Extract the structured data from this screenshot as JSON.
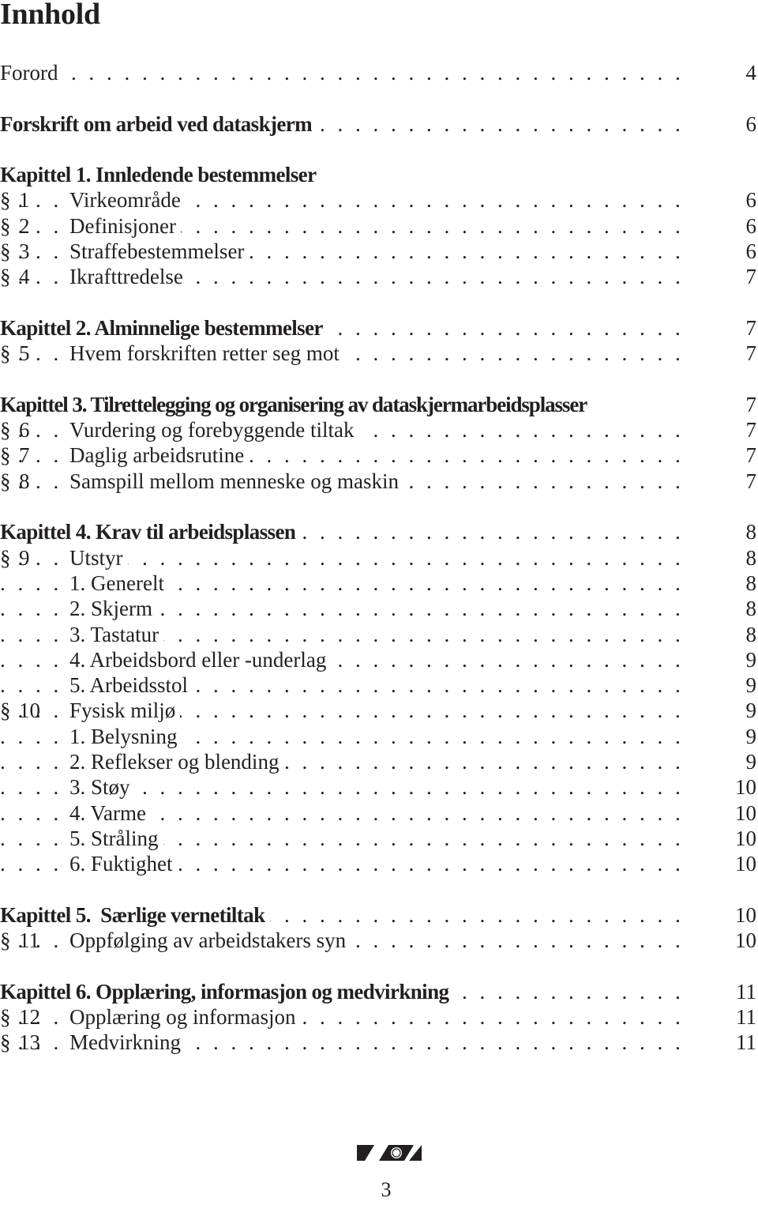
{
  "title": "Innhold",
  "leader_dots": ". . . . . . . . . . . . . . . . . . . . . . . . . . . . . . . . . . . . . . . . . . . . . . . . . . . . . . . . . . . . . . . . . . . .",
  "section_symbol": "§",
  "entries": [
    {
      "type": "plain",
      "label": "Forord",
      "page": "4"
    },
    {
      "type": "heading",
      "label": "Forskrift om arbeid ved dataskjerm",
      "page": "6"
    },
    {
      "type": "heading",
      "label": "Kapittel 1. Innledende bestemmelser",
      "page": ""
    },
    {
      "type": "section",
      "num": "1",
      "label": "Virkeområde",
      "page": "6"
    },
    {
      "type": "section",
      "num": "2",
      "label": "Definisjoner",
      "page": "6"
    },
    {
      "type": "section",
      "num": "3",
      "label": "Straffebestemmelser",
      "page": "6"
    },
    {
      "type": "section",
      "num": "4",
      "label": "Ikrafttredelse",
      "page": "7"
    },
    {
      "type": "heading",
      "label": "Kapittel 2. Alminnelige bestemmelser",
      "page": "7"
    },
    {
      "type": "section",
      "num": "5",
      "label": "Hvem forskriften retter seg mot",
      "page": "7"
    },
    {
      "type": "heading",
      "label": "Kapittel 3. Tilrettelegging og organisering av dataskjermarbeidsplasser",
      "page": "7"
    },
    {
      "type": "section",
      "num": "6",
      "label": "Vurdering og forebyggende tiltak",
      "page": "7"
    },
    {
      "type": "section",
      "num": "7",
      "label": "Daglig arbeidsrutine",
      "page": "7"
    },
    {
      "type": "section",
      "num": "8",
      "label": "Samspill mellom menneske og maskin",
      "page": "7"
    },
    {
      "type": "heading",
      "label": "Kapittel 4. Krav til arbeidsplassen",
      "page": "8"
    },
    {
      "type": "section",
      "num": "9",
      "label": "Utstyr",
      "page": "8"
    },
    {
      "type": "sub",
      "label": "1. Generelt",
      "page": "8"
    },
    {
      "type": "sub",
      "label": "2. Skjerm",
      "page": "8"
    },
    {
      "type": "sub",
      "label": "3. Tastatur",
      "page": "8"
    },
    {
      "type": "sub",
      "label": "4. Arbeidsbord eller -underlag",
      "page": "9"
    },
    {
      "type": "sub",
      "label": "5. Arbeidsstol",
      "page": "9"
    },
    {
      "type": "section",
      "num": "10",
      "label": "Fysisk miljø",
      "page": "9"
    },
    {
      "type": "sub",
      "label": "1. Belysning",
      "page": "9"
    },
    {
      "type": "sub",
      "label": "2. Reflekser og blending",
      "page": "9"
    },
    {
      "type": "sub",
      "label": "3. Støy",
      "page": "10"
    },
    {
      "type": "sub",
      "label": "4. Varme",
      "page": "10"
    },
    {
      "type": "sub",
      "label": "5. Stråling",
      "page": "10"
    },
    {
      "type": "sub",
      "label": "6. Fuktighet",
      "page": "10"
    },
    {
      "type": "heading",
      "label": "Kapittel 5.  Særlige vernetiltak",
      "page": "10"
    },
    {
      "type": "section",
      "num": "11",
      "label": "Oppfølging av arbeidstakers syn",
      "page": "10"
    },
    {
      "type": "heading",
      "label": "Kapittel 6. Opplæring, informasjon og medvirkning",
      "page": "11"
    },
    {
      "type": "section",
      "num": "12",
      "label": "Opplæring og informasjon",
      "page": "11"
    },
    {
      "type": "section",
      "num": "13",
      "label": "Medvirkning",
      "page": "11"
    }
  ],
  "footer": {
    "logo_icon": "arbeidstilsynet-logo-icon",
    "page_number": "3"
  }
}
